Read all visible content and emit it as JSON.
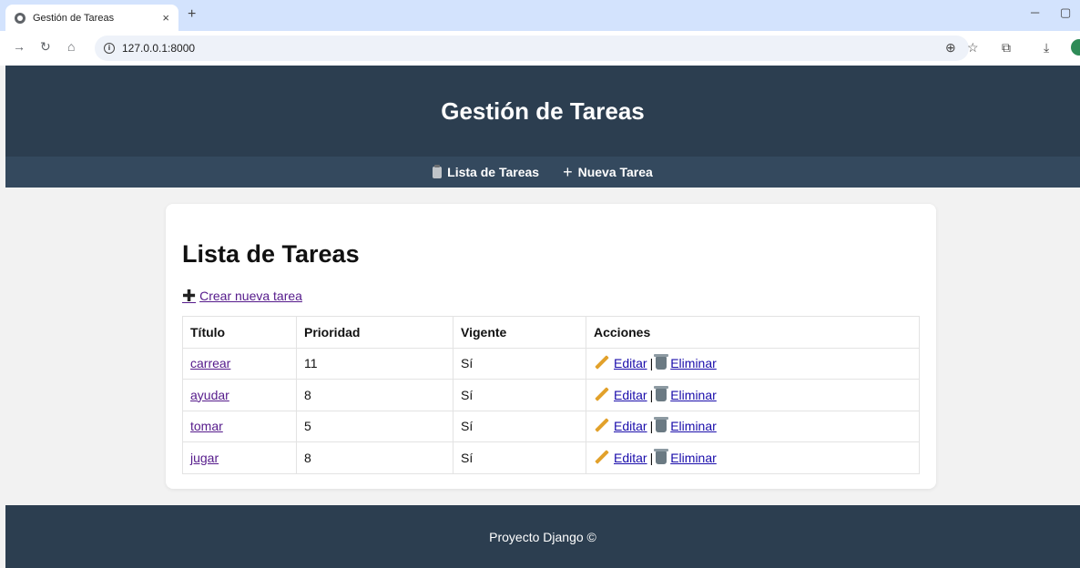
{
  "browser": {
    "tab_title": "Gestión de Tareas",
    "tab_close": "×",
    "new_tab": "+",
    "url": "127.0.0.1:8000"
  },
  "header": {
    "title": "Gestión de Tareas"
  },
  "nav": {
    "items": [
      {
        "label": "Lista de Tareas",
        "icon": "clipboard-icon"
      },
      {
        "label": "Nueva Tarea",
        "icon": "plus-icon"
      }
    ]
  },
  "main": {
    "heading": "Lista de Tareas",
    "create_link": "Crear nueva tarea",
    "table": {
      "columns": [
        "Título",
        "Prioridad",
        "Vigente",
        "Acciones"
      ],
      "rows": [
        {
          "titulo": "carrear",
          "prioridad": "11",
          "vigente": "Sí"
        },
        {
          "titulo": "ayudar",
          "prioridad": "8",
          "vigente": "Sí"
        },
        {
          "titulo": "tomar",
          "prioridad": "5",
          "vigente": "Sí"
        },
        {
          "titulo": "jugar",
          "prioridad": "8",
          "vigente": "Sí"
        }
      ],
      "edit_label": "Editar",
      "separator": "|",
      "delete_label": "Eliminar"
    }
  },
  "footer": {
    "text": "Proyecto Django ©"
  },
  "colors": {
    "header_bg": "#2c3e50",
    "nav_bg": "#34495e",
    "visited_link": "#551a8b",
    "action_link": "#1a0dab"
  }
}
